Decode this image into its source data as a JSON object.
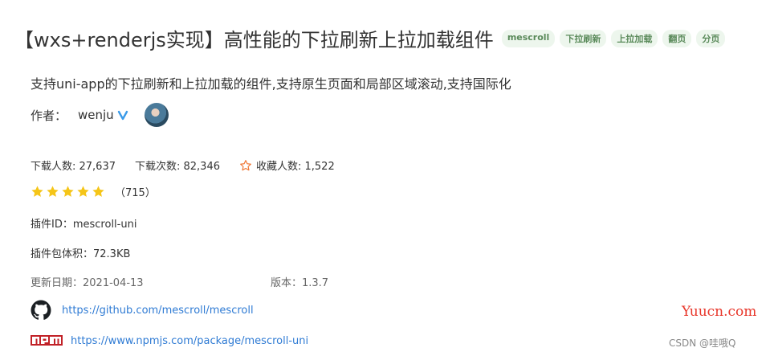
{
  "title": "【wxs+renderjs实现】高性能的下拉刷新上拉加载组件",
  "tags": [
    "mescroll",
    "下拉刷新",
    "上拉加载",
    "翻页",
    "分页"
  ],
  "description": "支持uni-app的下拉刷新和上拉加载的组件,支持原生页面和局部区域滚动,支持国际化",
  "author": {
    "label": "作者：",
    "name": "wenju"
  },
  "stats": {
    "downloads_users": "下载人数: 27,637",
    "downloads_count": "下载次数: 82,346",
    "favorites": "收藏人数: 1,522"
  },
  "rating": {
    "stars": 5,
    "count": "（715）"
  },
  "plugin_id": "插件ID：mescroll-uni",
  "package_size": "插件包体积：72.3KB",
  "updated": "更新日期：2021-04-13",
  "version": "版本：1.3.7",
  "links": {
    "github": "https://github.com/mescroll/mescroll",
    "npm": "https://www.npmjs.com/package/mescroll-uni"
  },
  "watermark": "Yuucn.com",
  "csdn": "CSDN @哇哦Q",
  "colors": {
    "tag_text": "#5a8a5a",
    "tag_bg": "#edf6ed",
    "link": "#2f7bd4",
    "star": "#f5c518",
    "watermark": "#e8372b"
  }
}
